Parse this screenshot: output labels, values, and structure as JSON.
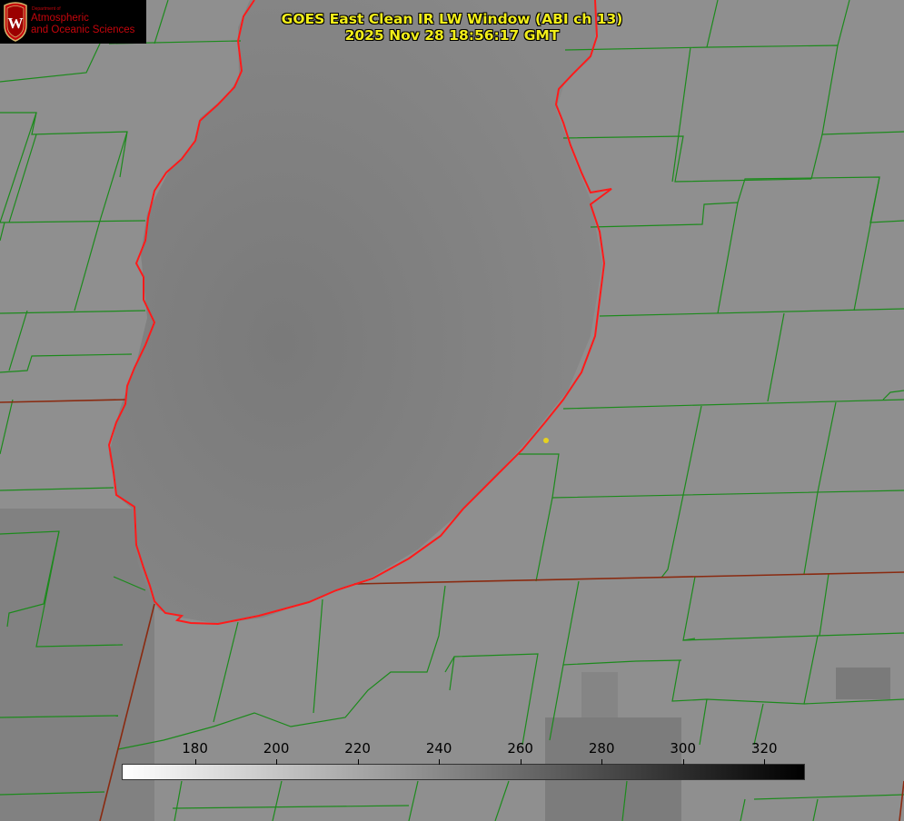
{
  "title": {
    "line1": "GOES East Clean IR LW Window (ABI ch 13)",
    "line2": "2025 Nov 28 18:56:17 GMT"
  },
  "logo": {
    "seal_letter": "W",
    "dept": "Department of",
    "line1": "Atmospheric",
    "line2": "and Oceanic Sciences"
  },
  "colorbar": {
    "min": 162,
    "max": 330,
    "ticks": [
      180,
      200,
      220,
      240,
      260,
      280,
      300,
      320
    ],
    "tick_labels": [
      "180",
      "200",
      "220",
      "240",
      "260",
      "280",
      "300",
      "320"
    ],
    "colors": {
      "low": "#ffffff",
      "high": "#000000"
    }
  },
  "map": {
    "county_border_color": "#1c8a1c",
    "lake_outline_color": "#ff1a1a",
    "marker_color": "#e6d21e",
    "features": [
      "lake",
      "county-borders",
      "state-borders",
      "marker"
    ]
  }
}
